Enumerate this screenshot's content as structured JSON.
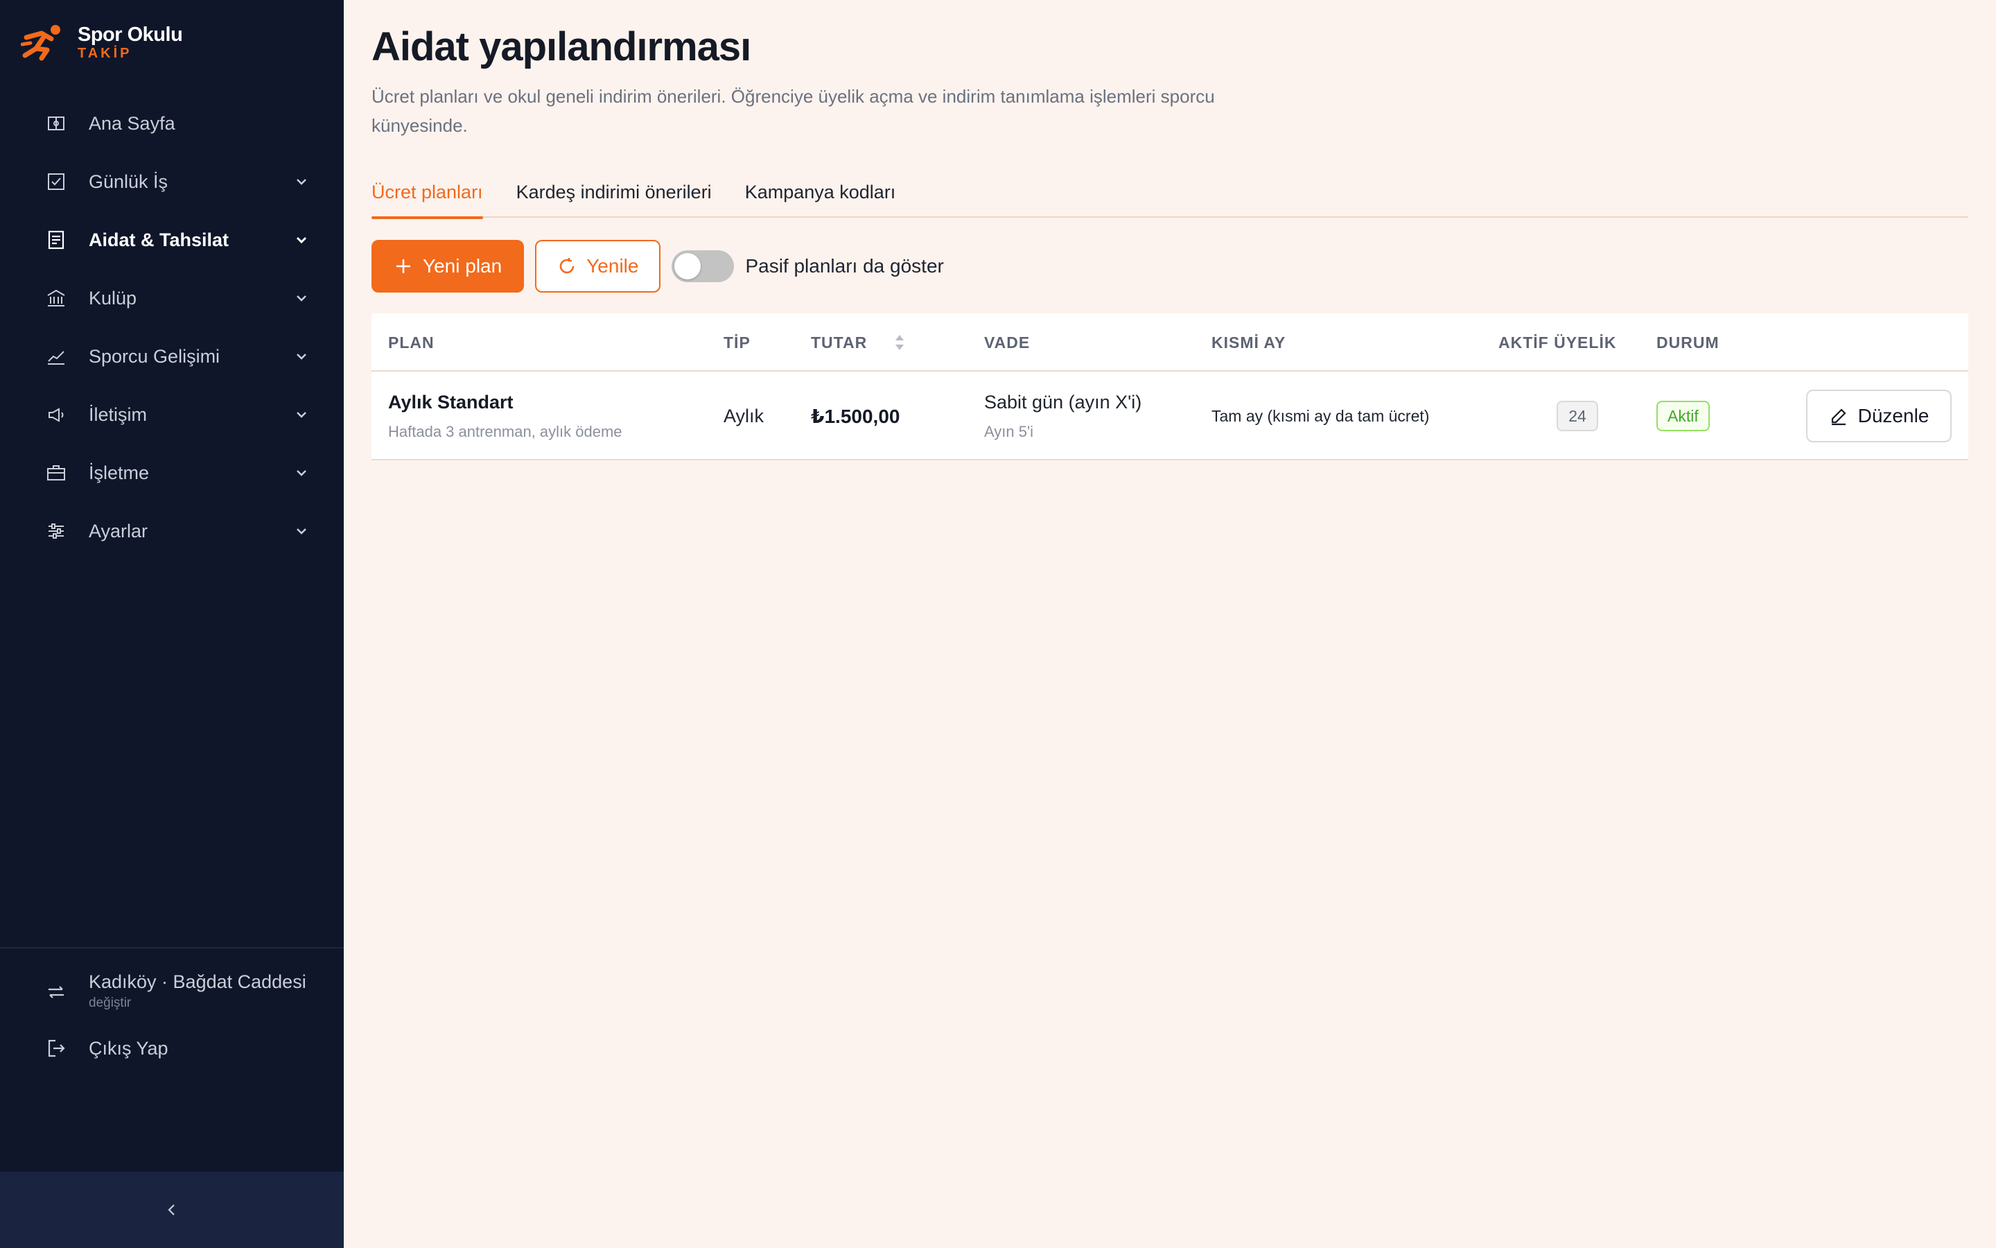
{
  "brand": {
    "name": "Spor Okulu",
    "sub": "TAKİP",
    "accent": "#f26a1b"
  },
  "sidebar": {
    "items": [
      {
        "label": "Ana Sayfa",
        "icon": "dashboard-icon"
      },
      {
        "label": "Günlük İş",
        "icon": "checkbox-icon"
      },
      {
        "label": "Aidat & Tahsilat",
        "icon": "document-icon"
      },
      {
        "label": "Kulüp",
        "icon": "bank-icon"
      },
      {
        "label": "Sporcu Gelişimi",
        "icon": "chart-line-icon"
      },
      {
        "label": "İletişim",
        "icon": "megaphone-icon"
      },
      {
        "label": "İşletme",
        "icon": "briefcase-icon"
      },
      {
        "label": "Ayarlar",
        "icon": "sliders-icon"
      }
    ],
    "branch": {
      "name": "Kadıköy · Bağdat Caddesi",
      "change_label": "değiştir"
    },
    "logout_label": "Çıkış Yap"
  },
  "page": {
    "title": "Aidat yapılandırması",
    "description": "Ücret planları ve okul geneli indirim önerileri. Öğrenciye üyelik açma ve indirim tanımlama işlemleri sporcu künyesinde."
  },
  "tabs": [
    {
      "label": "Ücret planları",
      "active": true
    },
    {
      "label": "Kardeş indirimi önerileri",
      "active": false
    },
    {
      "label": "Kampanya kodları",
      "active": false
    }
  ],
  "toolbar": {
    "new_plan_label": "Yeni plan",
    "refresh_label": "Yenile",
    "show_passive_label": "Pasif planları da göster",
    "show_passive_on": false
  },
  "table": {
    "headers": {
      "plan": "PLAN",
      "type": "TİP",
      "amount": "TUTAR",
      "due": "VADE",
      "partial": "KISMİ AY",
      "active_members": "AKTİF ÜYELİK",
      "status": "DURUM"
    },
    "rows": [
      {
        "plan_name": "Aylık Standart",
        "plan_desc": "Haftada 3 antrenman, aylık ödeme",
        "type": "Aylık",
        "amount": "₺1.500,00",
        "due": "Sabit gün (ayın X'i)",
        "due_sub": "Ayın 5'i",
        "partial": "Tam ay (kısmi ay da tam ücret)",
        "active_members": "24",
        "status": "Aktif",
        "edit_label": "Düzenle"
      }
    ]
  }
}
